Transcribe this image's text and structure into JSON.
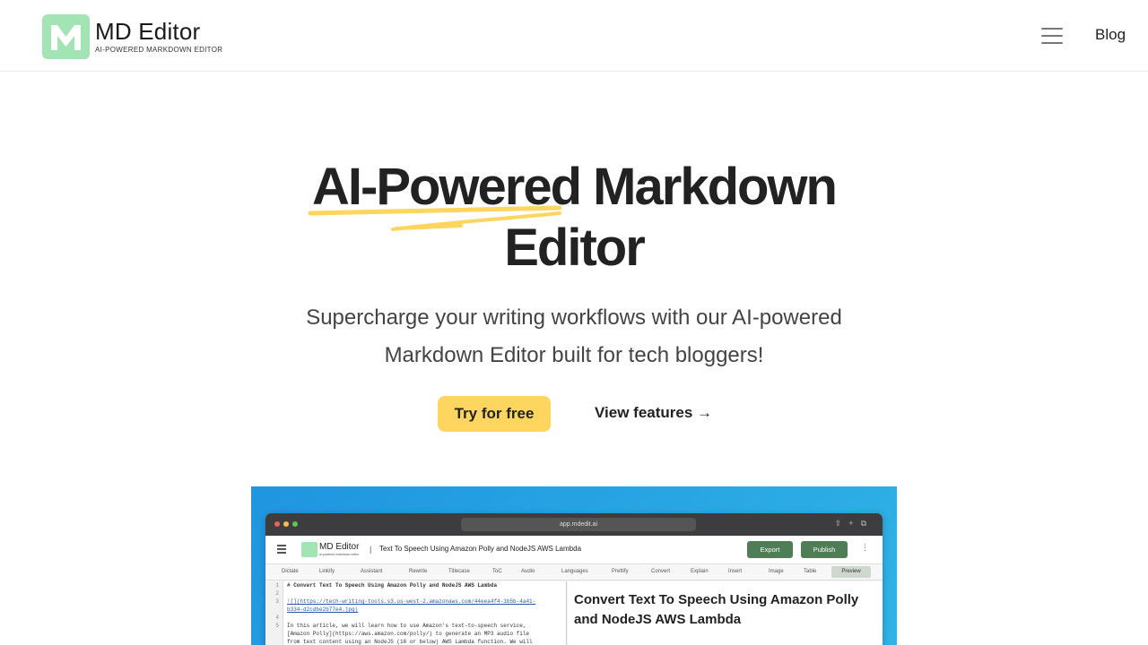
{
  "header": {
    "logo_letter": "M",
    "logo_title": "MD Editor",
    "logo_tagline": "AI-POWERED MARKDOWN EDITOR",
    "blog_label": "Blog",
    "brand_color": "#a3e4b5"
  },
  "hero": {
    "title_line1": "AI-Powered Markdown",
    "title_line2": "Editor",
    "subtitle": "Supercharge your writing workflows with our AI-powered Markdown Editor built for tech bloggers!",
    "cta_primary": "Try for free",
    "cta_secondary": "View features →",
    "accent_color": "#fdd55f"
  },
  "preview": {
    "url": "app.mdedit.ai",
    "app_logo_text": "MD Editor",
    "app_logo_sub": "ai-powered markdown editor",
    "separator": "|",
    "doc_title": "Text To Speech Using Amazon Polly and NodeJS AWS Lambda",
    "export_label": "Export",
    "publish_label": "Publish",
    "more_label": "⋮",
    "toolbar": [
      "Dictate",
      "Linkify",
      "Assistant",
      "Rewrite",
      "Titlecase",
      "ToC",
      "Audio",
      "Languages",
      "Prettify",
      "Convert",
      "Explain",
      "Insert",
      "Image",
      "Table"
    ],
    "preview_label": "Preview",
    "line_numbers": [
      "1",
      "2",
      "3",
      "",
      "4",
      "5",
      "",
      ""
    ],
    "code_lines": [
      "# Convert Text To Speech Using Amazon Polly and NodeJS AWS Lambda",
      "",
      "![](https://tech-writing-tools.s3.us-west-2.amazonaws.com/44eea4f4-1b5b-4a41-",
      "b334-d2cdbe2b77e4.jpg)",
      "",
      "In this article, we will learn how to use Amazon's text-to-speech service,",
      "[Amazon Polly](https://aws.amazon.com/polly/) to generate an MP3 audio file",
      "from text content using an NodeJS (16 or below) AWS Lambda function. We will"
    ],
    "render_title": "Convert Text To Speech Using Amazon Polly and NodeJS AWS Lambda"
  }
}
